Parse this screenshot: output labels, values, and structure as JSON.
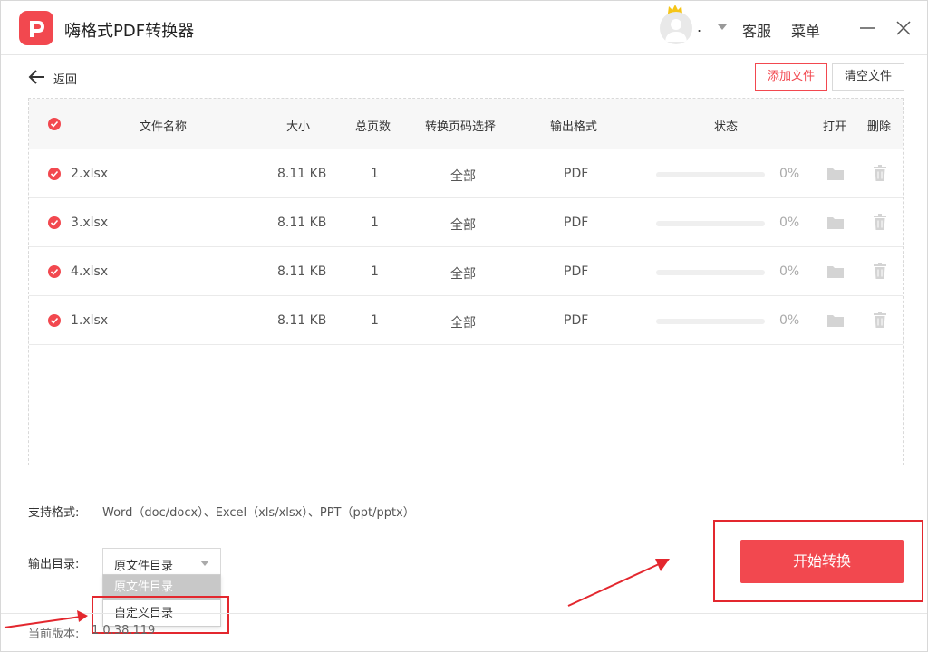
{
  "app": {
    "title": "嗨格式PDF转换器"
  },
  "user": {
    "name": "."
  },
  "header": {
    "service_label": "客服",
    "menu_label": "菜单"
  },
  "toolbar": {
    "back_label": "返回",
    "add_file_label": "添加文件",
    "clear_file_label": "清空文件"
  },
  "table": {
    "columns": {
      "name": "文件名称",
      "size": "大小",
      "pages": "总页数",
      "page_select": "转换页码选择",
      "format": "输出格式",
      "status": "状态",
      "open": "打开",
      "delete": "删除"
    },
    "rows": [
      {
        "name": "2.xlsx",
        "size": "8.11 KB",
        "pages": "1",
        "page_select": "全部",
        "format": "PDF",
        "progress": "0%"
      },
      {
        "name": "3.xlsx",
        "size": "8.11 KB",
        "pages": "1",
        "page_select": "全部",
        "format": "PDF",
        "progress": "0%"
      },
      {
        "name": "4.xlsx",
        "size": "8.11 KB",
        "pages": "1",
        "page_select": "全部",
        "format": "PDF",
        "progress": "0%"
      },
      {
        "name": "1.xlsx",
        "size": "8.11 KB",
        "pages": "1",
        "page_select": "全部",
        "format": "PDF",
        "progress": "0%"
      }
    ]
  },
  "support": {
    "label": "支持格式:",
    "value": "Word（doc/docx）、Excel（xls/xlsx）、PPT（ppt/pptx）"
  },
  "output": {
    "label": "输出目录:",
    "selected": "原文件目录",
    "options": [
      "原文件目录",
      "自定义目录"
    ]
  },
  "actions": {
    "start_label": "开始转换"
  },
  "footer": {
    "version_label": "当前版本:",
    "version_value": "1.0.38.119"
  },
  "colors": {
    "accent": "#f2484f",
    "annotation": "#e3272e"
  }
}
